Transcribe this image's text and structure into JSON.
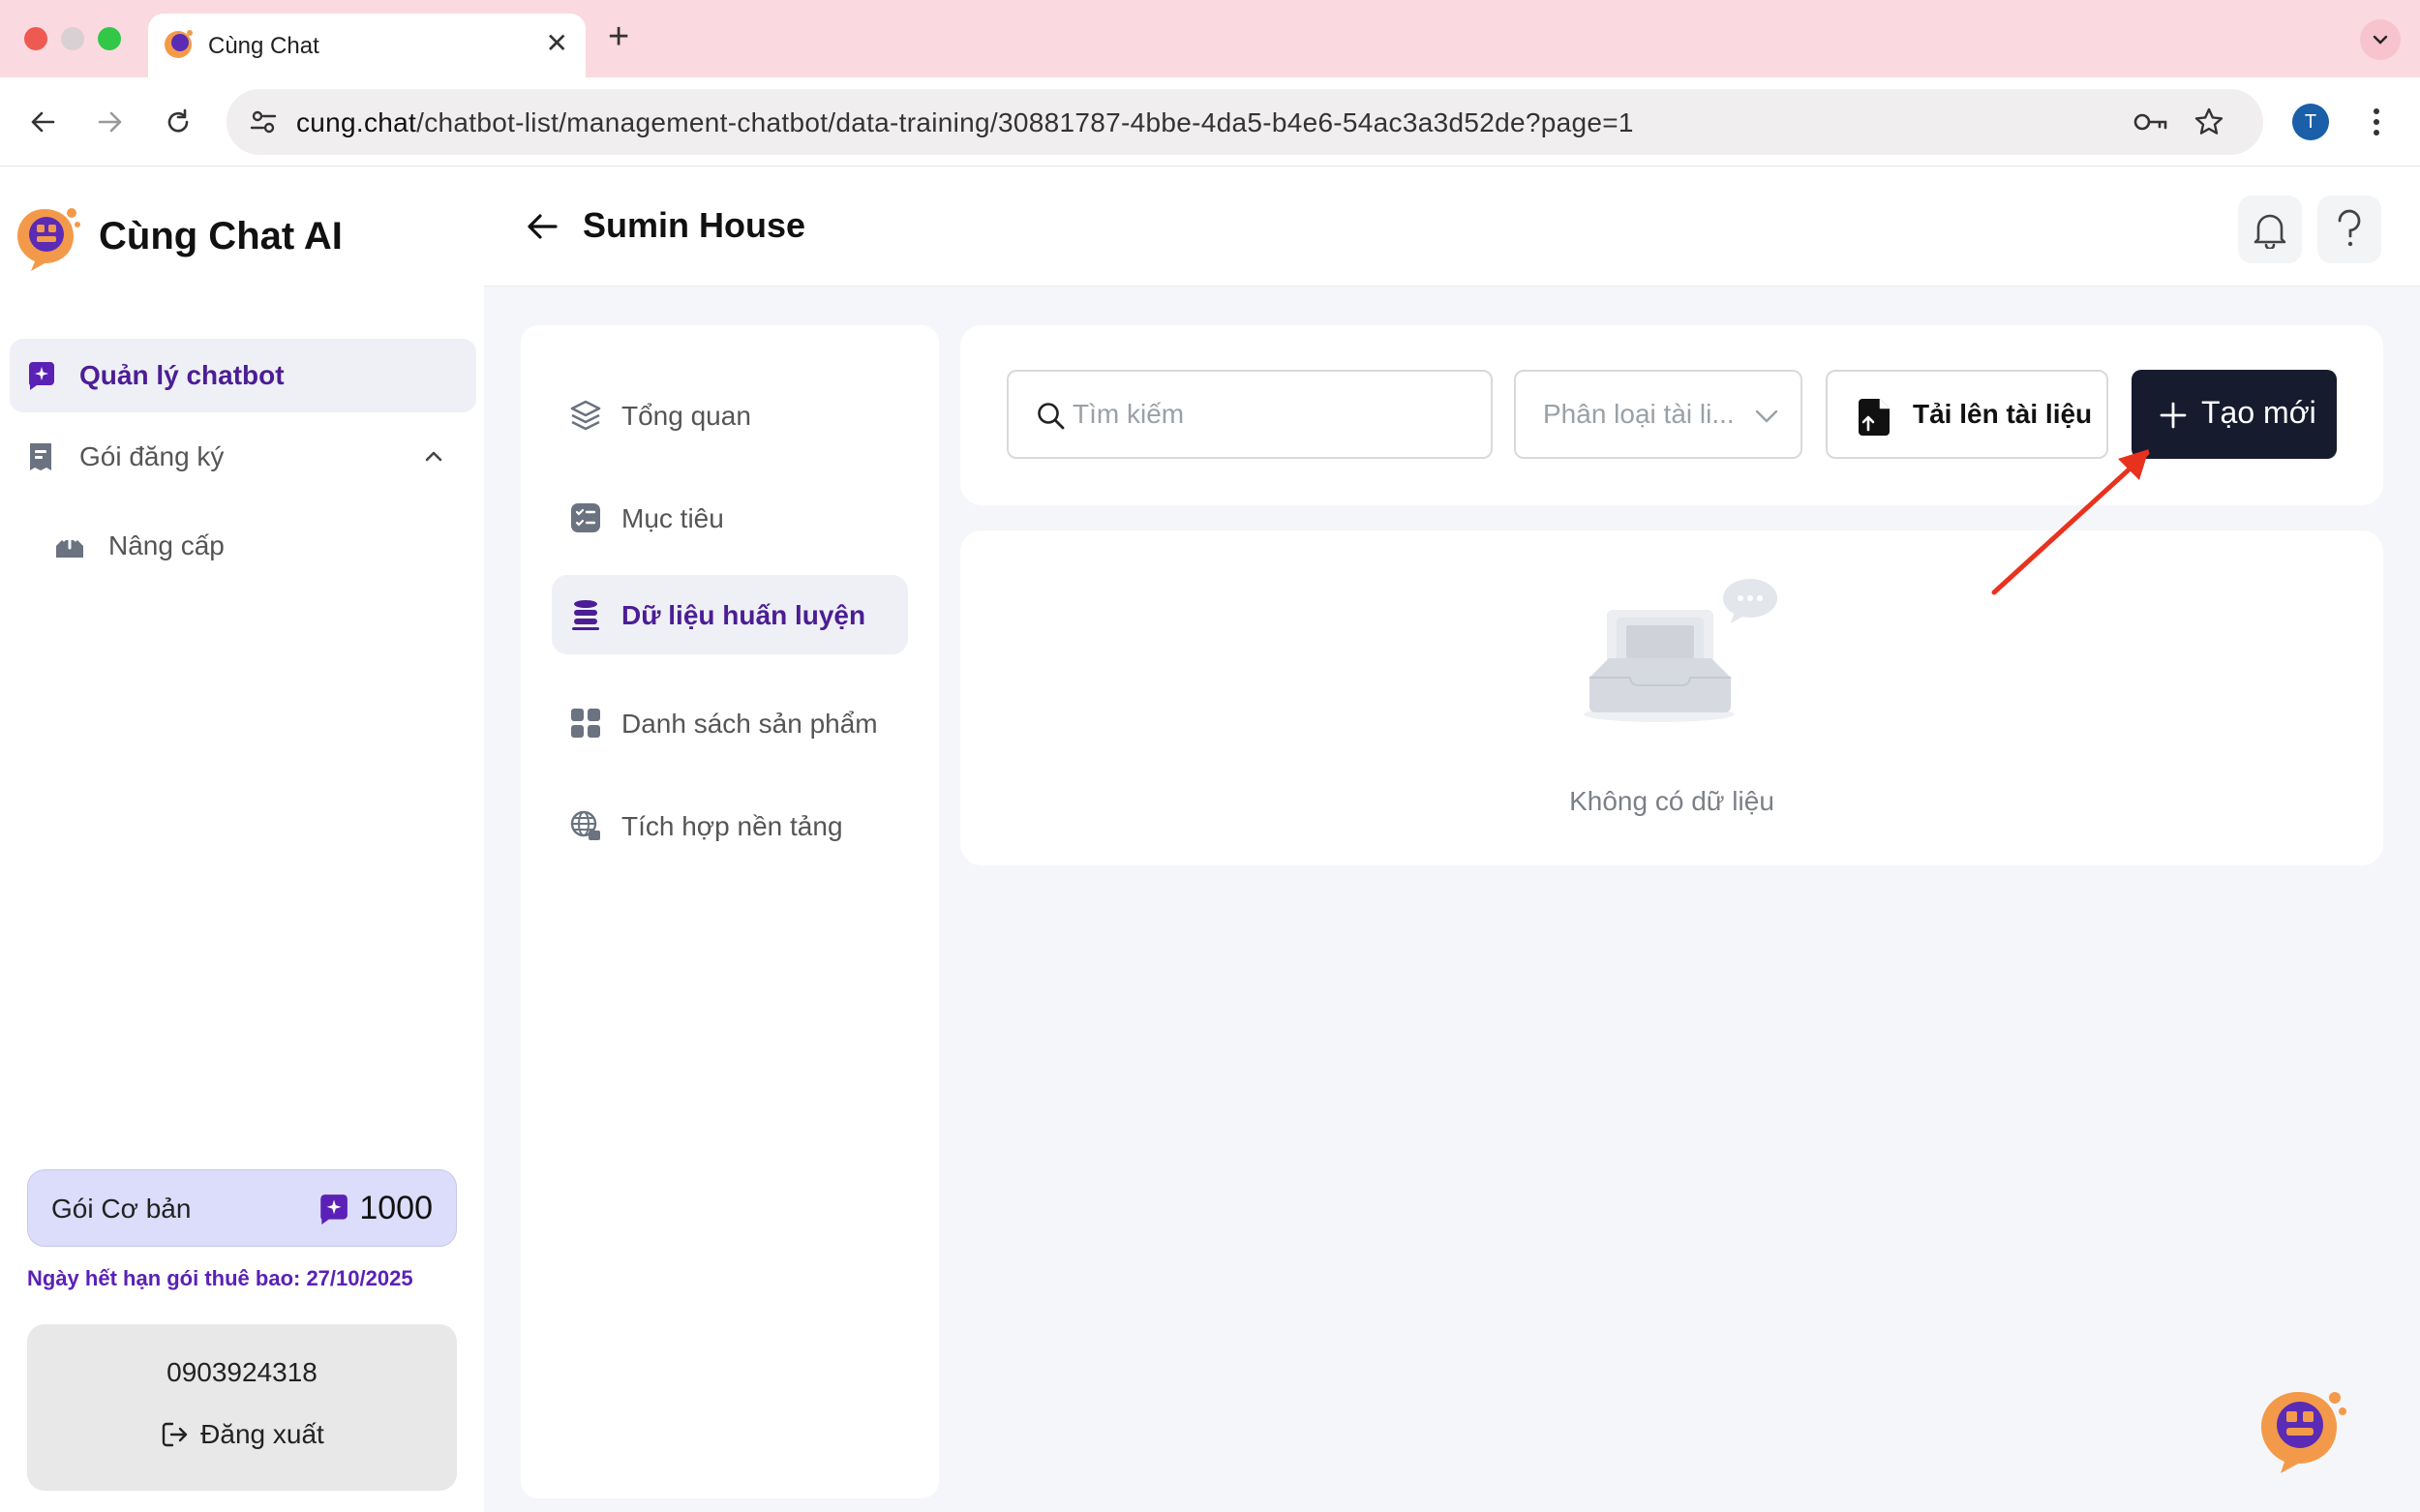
{
  "browser": {
    "tab_title": "Cùng Chat",
    "new_tab": "+",
    "close": "✕",
    "url_host": "cung.chat",
    "url_path": "/chatbot-list/management-chatbot/data-training/30881787-4bbe-4da5-b4e6-54ac3a3d52de?page=1",
    "profile_initial": "T"
  },
  "sidebar": {
    "brand": "Cùng Chat AI",
    "items": [
      {
        "label": "Quản lý chatbot",
        "icon": "chat-sparkle-icon",
        "active": true
      },
      {
        "label": "Gói đăng ký",
        "icon": "receipt-icon",
        "expanded": true
      },
      {
        "label": "Nâng cấp",
        "icon": "inbox-upload-icon"
      }
    ],
    "plan": {
      "name": "Gói Cơ bản",
      "credits": "1000"
    },
    "expiry": "Ngày hết hạn gói thuê bao: 27/10/2025",
    "account": {
      "phone": "0903924318",
      "logout": "Đăng xuất"
    }
  },
  "header": {
    "title": "Sumin House"
  },
  "submenu": {
    "items": [
      {
        "label": "Tổng quan",
        "icon": "layers-icon"
      },
      {
        "label": "Mục tiêu",
        "icon": "checklist-icon"
      },
      {
        "label": "Dữ liệu huấn luyện",
        "icon": "database-icon",
        "active": true
      },
      {
        "label": "Danh sách sản phẩm",
        "icon": "grid-icon"
      },
      {
        "label": "Tích hợp nền tảng",
        "icon": "globe-icon"
      }
    ]
  },
  "toolbar": {
    "search_placeholder": "Tìm kiếm",
    "category_placeholder": "Phân loại tài li...",
    "upload_label": "Tải lên tài liệu",
    "create_label": "Tạo mới"
  },
  "empty": {
    "text": "Không có dữ liệu"
  },
  "colors": {
    "accent": "#4c1d95",
    "primary_button": "#161b2e",
    "annotation_arrow": "#e8321e"
  }
}
